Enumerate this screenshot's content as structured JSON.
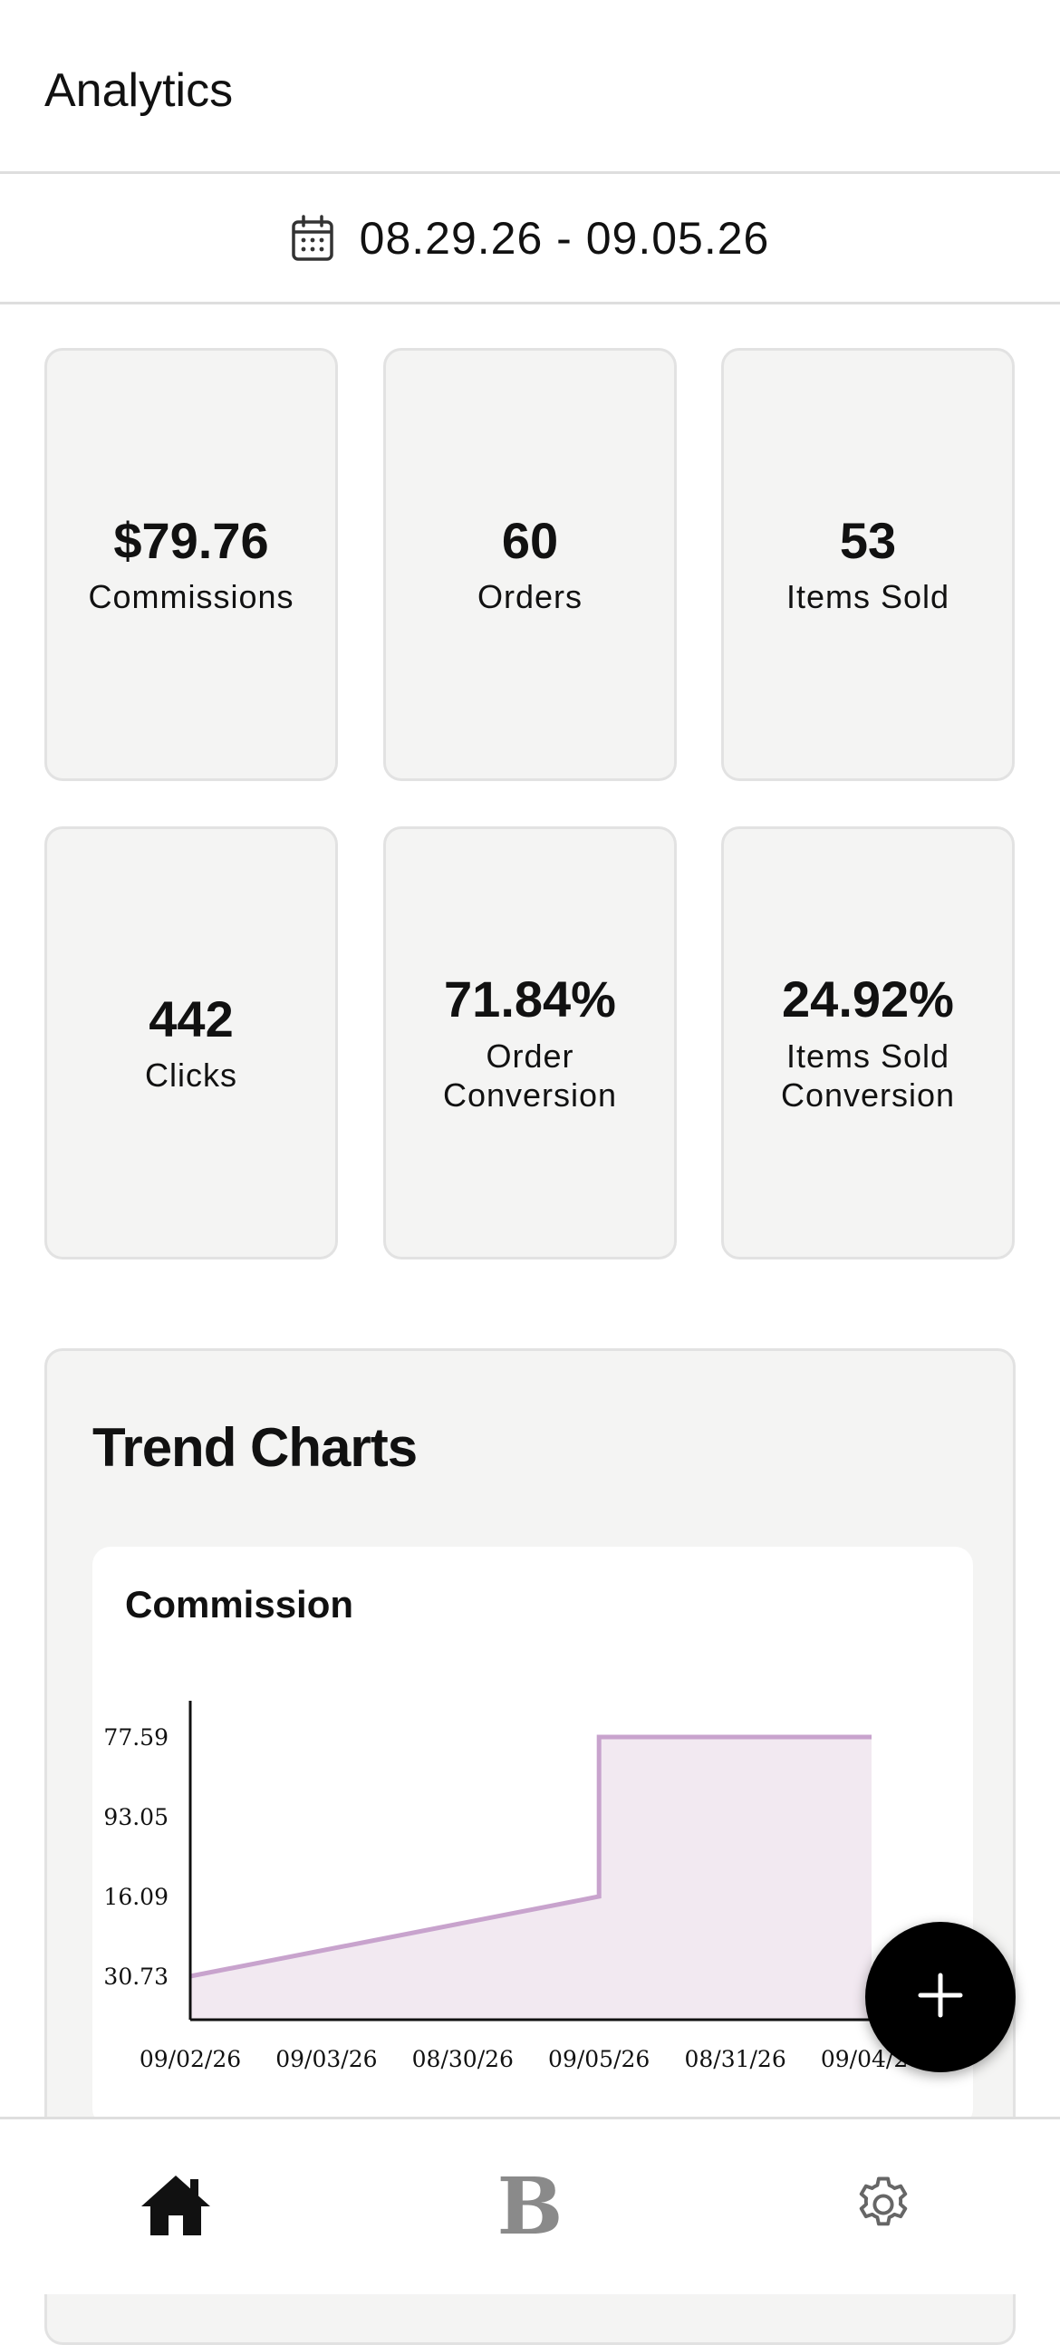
{
  "header": {
    "title": "Analytics"
  },
  "date_range": {
    "icon": "calendar-icon",
    "text": "08.29.26 - 09.05.26"
  },
  "stats": [
    {
      "value": "$79.76",
      "label": "Commissions"
    },
    {
      "value": "60",
      "label": "Orders"
    },
    {
      "value": "53",
      "label": "Items Sold"
    },
    {
      "value": "442",
      "label": "Clicks"
    },
    {
      "value": "71.84%",
      "label": "Order Conversion"
    },
    {
      "value": "24.92%",
      "label": "Items Sold Conversion"
    }
  ],
  "trend": {
    "title": "Trend Charts",
    "chart_title": "Commission"
  },
  "chart_data": {
    "type": "area",
    "x": [
      "09/02/26",
      "09/03/26",
      "08/30/26",
      "09/05/26",
      "08/31/26",
      "09/04/26"
    ],
    "y_tick_labels": [
      "77.59",
      "93.05",
      "16.09",
      "30.73"
    ],
    "series": [
      {
        "values": [
          {
            "x": "09/02/26",
            "y": 30.73
          },
          {
            "x": "09/05/26",
            "y": 16.09
          },
          {
            "x": "09/05/26",
            "y": 77.59
          },
          {
            "x": "09/04/26",
            "y": 77.59
          }
        ],
        "color": "#c8a3cd",
        "fill": "#f2e9f1"
      }
    ],
    "grid": false,
    "legend": "none"
  },
  "colors": {
    "accent_line": "#c8a3cd",
    "accent_fill": "#f2e9f1",
    "card_bg": "#f4f4f3",
    "fab_bg": "#000000",
    "nav_inactive": "#8a8a8a"
  },
  "fab": {
    "icon": "plus-icon"
  },
  "nav": {
    "items": [
      {
        "icon": "home-icon",
        "active": true
      },
      {
        "icon": "b-logo-icon",
        "label": "B",
        "active": false
      },
      {
        "icon": "gear-icon",
        "active": false
      }
    ]
  }
}
